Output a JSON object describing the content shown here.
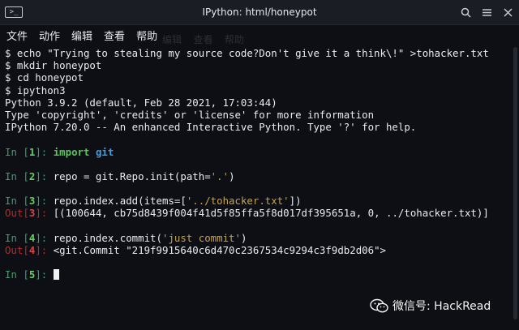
{
  "window": {
    "title": "IPython: html/honeypot",
    "icon": "terminal-icon",
    "buttons": [
      "search-icon",
      "menu-icon",
      "close-icon"
    ]
  },
  "menu": [
    "文件",
    "动作",
    "编辑",
    "查看",
    "帮助"
  ],
  "shell_lines": [
    "$ echo \"Trying to stealing my source code?Don't give it a think\\!\" >tohacker.txt",
    "$ mkdir honeypot",
    "$ cd honeypot",
    "$ ipython3",
    "Python 3.9.2 (default, Feb 28 2021, 17:03:44)",
    "Type 'copyright', 'credits' or 'license' for more information",
    "IPython 7.20.0 -- An enhanced Interactive Python. Type '?' for help."
  ],
  "cells": [
    {
      "in_label": "In [",
      "in_num": "1",
      "in_end": "]: ",
      "parts": [
        {
          "t": "import",
          "c": "kw"
        },
        {
          "t": " ",
          "c": ""
        },
        {
          "t": "git",
          "c": "mod"
        }
      ]
    },
    {
      "in_label": "In [",
      "in_num": "2",
      "in_end": "]: ",
      "parts": [
        {
          "t": "repo = git.Repo.init(path=",
          "c": ""
        },
        {
          "t": "'.'",
          "c": "str"
        },
        {
          "t": ")",
          "c": ""
        }
      ]
    },
    {
      "in_label": "In [",
      "in_num": "3",
      "in_end": "]: ",
      "parts": [
        {
          "t": "repo.index.add(items=[",
          "c": ""
        },
        {
          "t": "'../tohacker.txt'",
          "c": "str"
        },
        {
          "t": "])",
          "c": ""
        }
      ],
      "out_label": "Out[",
      "out_num": "3",
      "out_end": "]: ",
      "out_text": "[(100644, cb75d8439f004f41d5f85ffa5f8d017df395651a, 0, ../tohacker.txt)]"
    },
    {
      "in_label": "In [",
      "in_num": "4",
      "in_end": "]: ",
      "parts": [
        {
          "t": "repo.index.commit(",
          "c": ""
        },
        {
          "t": "'just commit'",
          "c": "str"
        },
        {
          "t": ")",
          "c": ""
        }
      ],
      "out_label": "Out[",
      "out_num": "4",
      "out_end": "]: ",
      "out_text": "<git.Commit \"219f9915640c6d470c2367534c9294c3f9db2d06\">"
    },
    {
      "in_label": "In [",
      "in_num": "5",
      "in_end": "]: ",
      "parts": [],
      "cursor": true
    }
  ],
  "watermark": {
    "icon": "wechat-icon",
    "text": "微信号: HackRead"
  },
  "colors": {
    "background": "#0d0f14",
    "prompt_in": "#38a169",
    "prompt_out": "#b22a2a",
    "keyword": "#58c558",
    "module": "#3ea0e0",
    "string": "#c9a24a"
  }
}
